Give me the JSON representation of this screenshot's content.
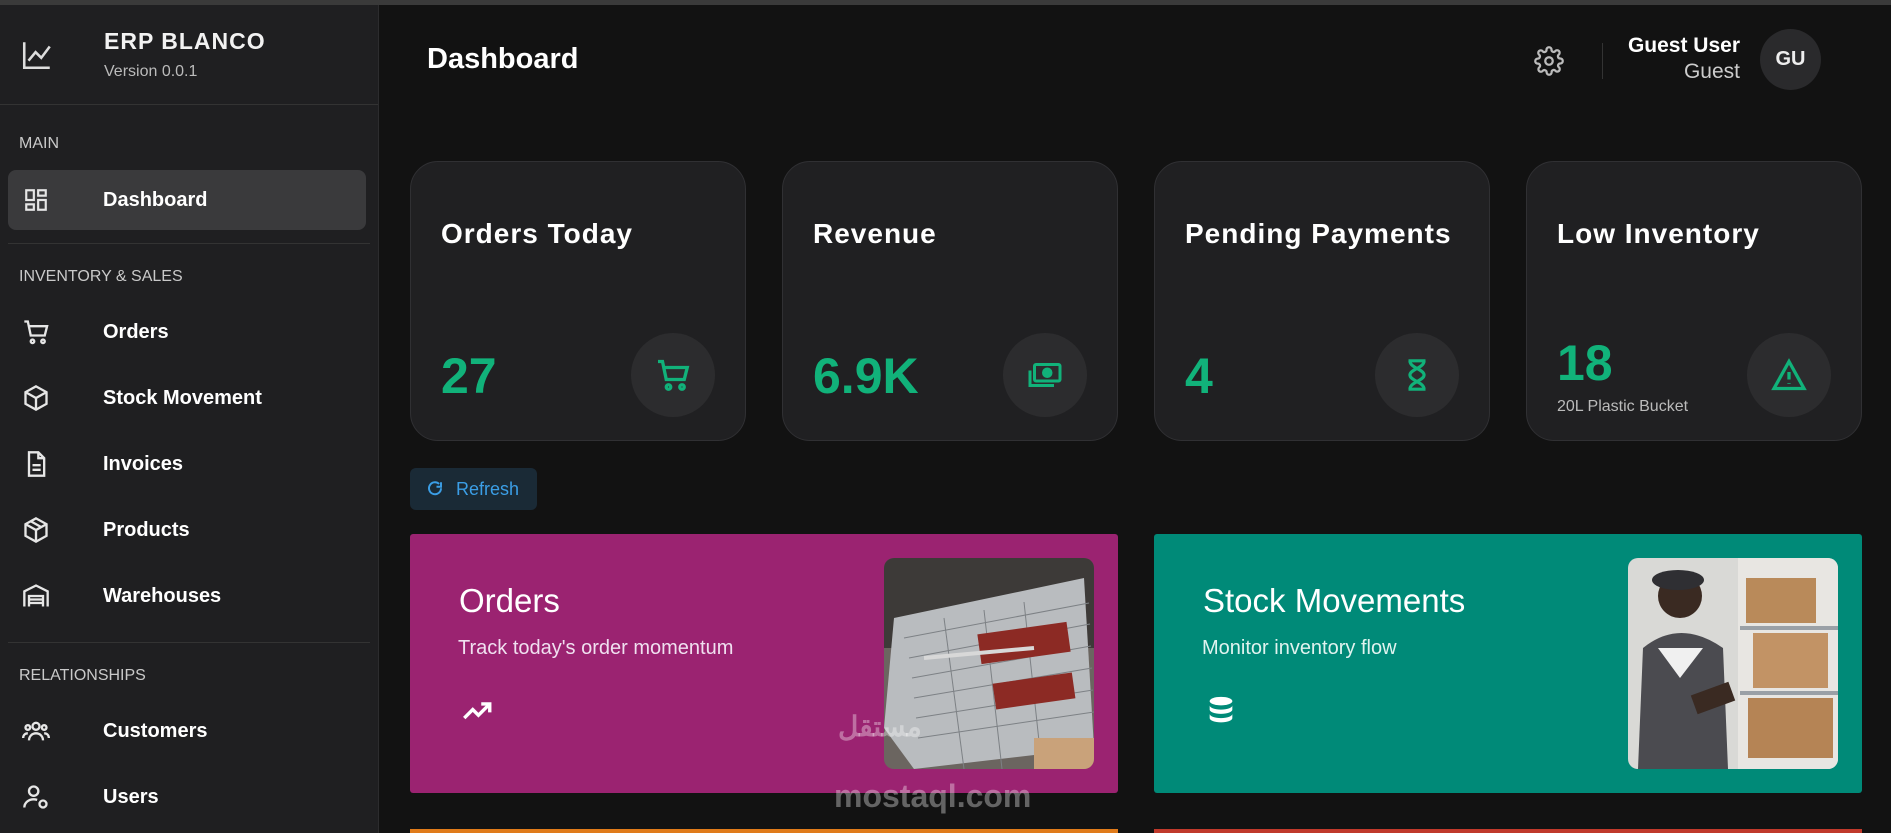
{
  "brand": {
    "name": "ERP BLANCO",
    "version": "Version 0.0.1"
  },
  "sidebar": {
    "sections": [
      {
        "title": "MAIN"
      },
      {
        "title": "INVENTORY & SALES"
      },
      {
        "title": "RELATIONSHIPS"
      }
    ],
    "items": [
      {
        "label": "Dashboard",
        "icon": "dashboard-icon"
      },
      {
        "label": "Orders",
        "icon": "cart-icon"
      },
      {
        "label": "Stock Movement",
        "icon": "cube-icon"
      },
      {
        "label": "Invoices",
        "icon": "document-icon"
      },
      {
        "label": "Products",
        "icon": "box-icon"
      },
      {
        "label": "Warehouses",
        "icon": "warehouse-icon"
      },
      {
        "label": "Customers",
        "icon": "people-icon"
      },
      {
        "label": "Users",
        "icon": "user-gear-icon"
      }
    ]
  },
  "header": {
    "title": "Dashboard",
    "user_name": "Guest User",
    "user_role": "Guest",
    "avatar_initials": "GU"
  },
  "stats": [
    {
      "title": "Orders Today",
      "value": "27",
      "icon": "cart-icon"
    },
    {
      "title": "Revenue",
      "value": "6.9K",
      "icon": "money-icon"
    },
    {
      "title": "Pending Payments",
      "value": "4",
      "icon": "hourglass-icon"
    },
    {
      "title": "Low Inventory",
      "value": "18",
      "sub": "20L Plastic Bucket",
      "icon": "warning-icon"
    }
  ],
  "refresh_label": "Refresh",
  "features": [
    {
      "title": "Orders",
      "subtitle": "Track today's order momentum",
      "icon": "trending-up-icon",
      "color": "#9b2371"
    },
    {
      "title": "Stock Movements",
      "subtitle": "Monitor inventory flow",
      "icon": "database-icon",
      "color": "#008a78"
    }
  ],
  "watermark": {
    "arabic": "مستقل",
    "latin": "mostaql.com"
  },
  "colors": {
    "accent": "#11b27a",
    "refresh": "#3b9ee6",
    "orange_strip": "#e07b1a",
    "red_strip": "#c0392b"
  }
}
